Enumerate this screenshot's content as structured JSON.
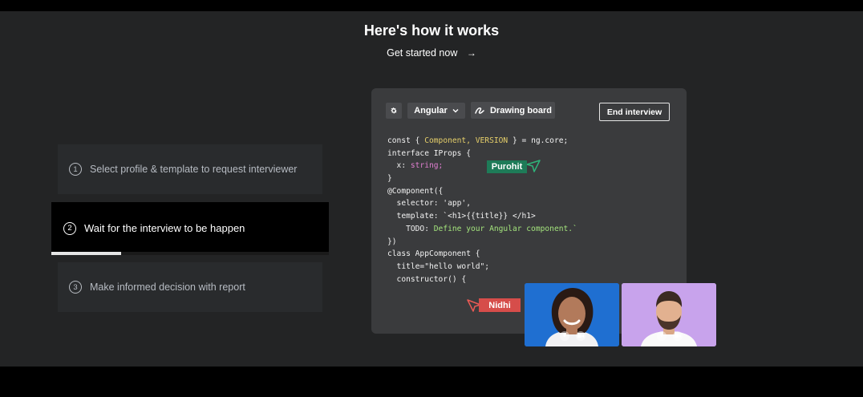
{
  "header": {
    "title": "Here's how it works",
    "cta_label": "Get started now",
    "cta_arrow": "→"
  },
  "steps": [
    {
      "number": "1",
      "label": "Select profile & template to request interviewer",
      "state": "inactive"
    },
    {
      "number": "2",
      "label": "Wait for the interview to be happen",
      "state": "active"
    },
    {
      "number": "3",
      "label": "Make informed decision with report",
      "state": "inactive"
    }
  ],
  "active_step_progress": 0.25,
  "editor": {
    "settings_icon": "gear-icon",
    "language": "Angular",
    "language_icon": "chevron-down-icon",
    "drawing_board_label": "Drawing board",
    "drawing_board_icon": "scribble-icon",
    "end_interview_label": "End interview",
    "code_lines": [
      [
        {
          "t": "const { "
        },
        {
          "t": "Component, VERSION",
          "c": "yellow"
        },
        {
          "t": " } = ng.core;"
        }
      ],
      [
        {
          "t": "interface IProps {"
        }
      ],
      [
        {
          "t": "  x: "
        },
        {
          "t": "string;",
          "c": "pink"
        }
      ],
      [
        {
          "t": "}"
        }
      ],
      [
        {
          "t": "@Component({"
        }
      ],
      [
        {
          "t": "  selector: 'app',"
        }
      ],
      [
        {
          "t": "  template: `<h1>{{title}} </h1>"
        }
      ],
      [
        {
          "t": "    TODO: "
        },
        {
          "t": "Define your Angular component.`",
          "c": "green"
        }
      ],
      [
        {
          "t": "})"
        }
      ],
      [
        {
          "t": "class AppComponent {"
        }
      ],
      [
        {
          "t": "  title=\"hello world\";"
        }
      ],
      [
        {
          "t": "  constructor() {"
        }
      ]
    ]
  },
  "cursors": {
    "purohit": {
      "name": "Purohit",
      "color": "#1e7b58"
    },
    "nidhi": {
      "name": "Nidhi",
      "color": "#d64d4a"
    }
  },
  "videos": [
    {
      "participant": "woman-avatar",
      "background": "#1f6fd1"
    },
    {
      "participant": "man-avatar",
      "background": "#c8a3ec"
    }
  ],
  "colors": {
    "background": "#232425",
    "step_inactive_bg": "#292b2d",
    "step_active_bg": "#000000",
    "editor_bg": "#3a3b3d"
  }
}
